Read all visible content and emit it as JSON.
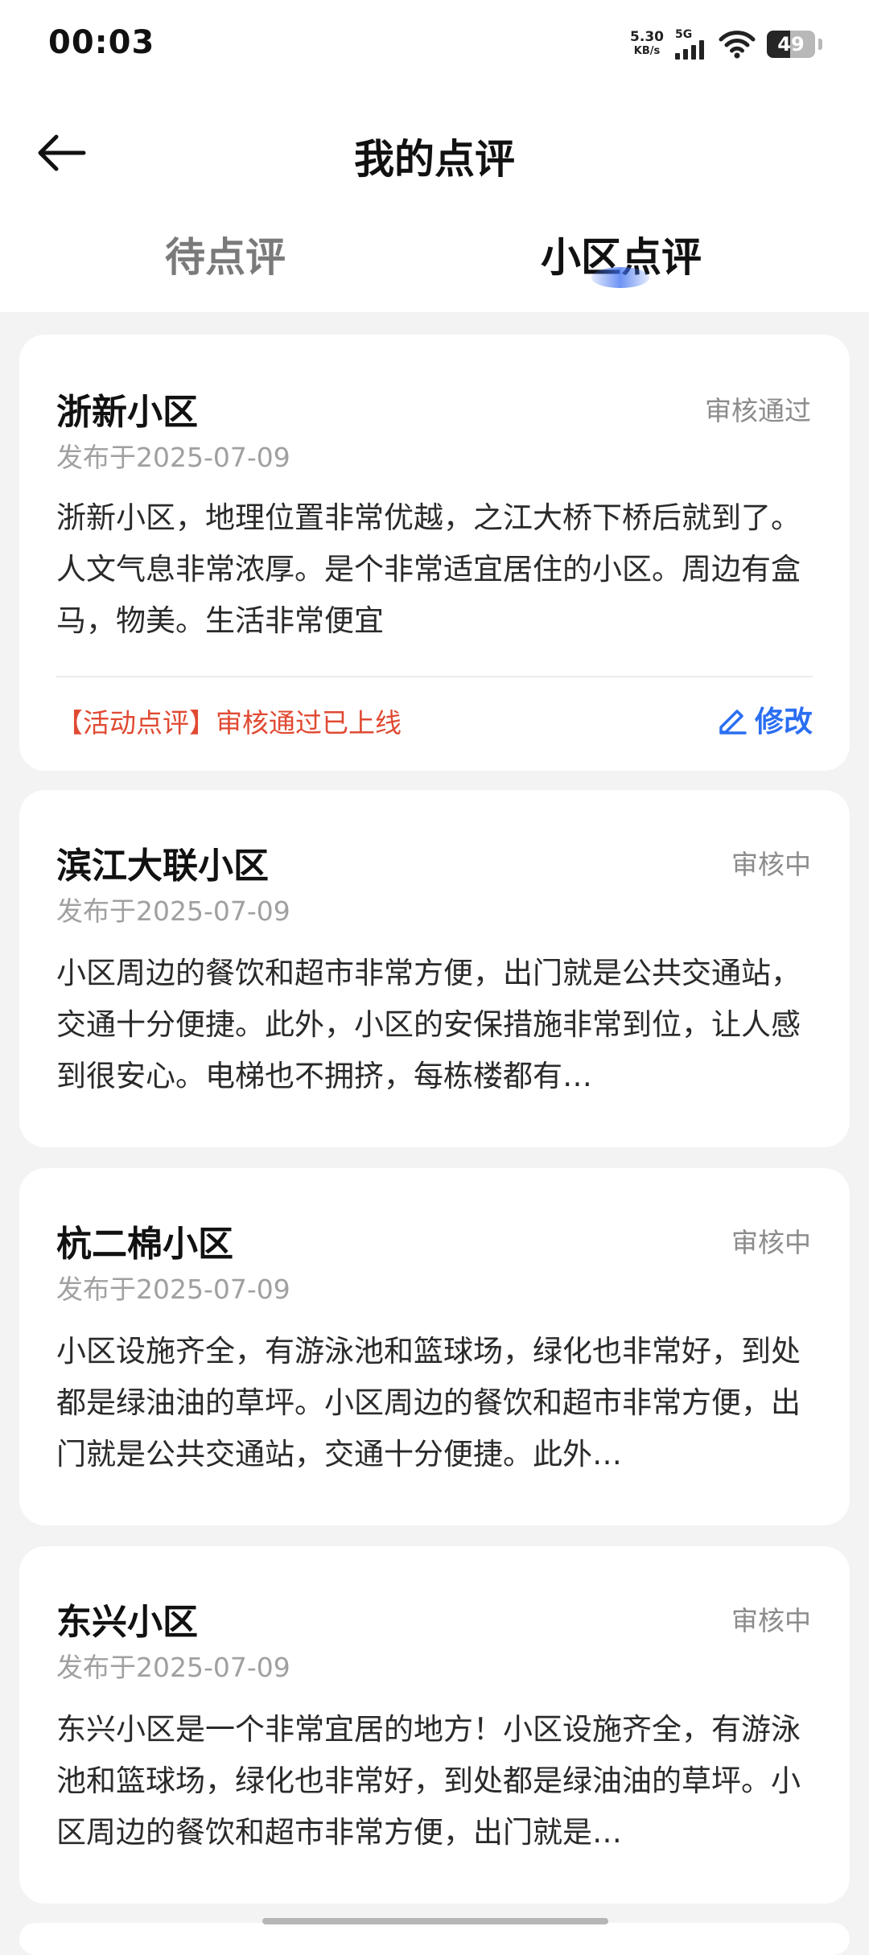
{
  "status_bar": {
    "time": "00:03",
    "net_speed": "5.30",
    "net_unit": "KB/s",
    "network": "5G",
    "battery": "49",
    "battery_level": 0.49,
    "icons": [
      "signal-bars-icon",
      "wifi-icon",
      "battery-icon"
    ]
  },
  "header": {
    "back_icon": "back-arrow-icon",
    "title": "我的点评"
  },
  "tabs": [
    {
      "label": "待点评",
      "active": false
    },
    {
      "label": "小区点评",
      "active": true
    }
  ],
  "colors": {
    "accent": "#2a6ef2",
    "alert": "#e04a33",
    "status_text": "#8c8c8c"
  },
  "reviews": [
    {
      "name": "浙新小区",
      "status": "审核通过",
      "date": "发布于2025-07-09",
      "text": "浙新小区，地理位置非常优越，之江大桥下桥后就到了。人文气息非常浓厚。是个非常适宜居住的小区。周边有盒马，物美。生活非常便宜",
      "note": "【活动点评】审核通过已上线",
      "edit_label": "修改",
      "edit_icon": "pencil-icon"
    },
    {
      "name": "滨江大联小区",
      "status": "审核中",
      "date": "发布于2025-07-09",
      "text": "小区周边的餐饮和超市非常方便，出门就是公共交通站，交通十分便捷。此外，小区的安保措施非常到位，让人感到很安心。电梯也不拥挤，每栋楼都有…"
    },
    {
      "name": "杭二棉小区",
      "status": "审核中",
      "date": "发布于2025-07-09",
      "text": "小区设施齐全，有游泳池和篮球场，绿化也非常好，到处都是绿油油的草坪。小区周边的餐饮和超市非常方便，出门就是公共交通站，交通十分便捷。此外…"
    },
    {
      "name": "东兴小区",
      "status": "审核中",
      "date": "发布于2025-07-09",
      "text": "东兴小区是一个非常宜居的地方！小区设施齐全，有游泳池和篮球场，绿化也非常好，到处都是绿油油的草坪。小区周边的餐饮和超市非常方便，出门就是…"
    }
  ]
}
